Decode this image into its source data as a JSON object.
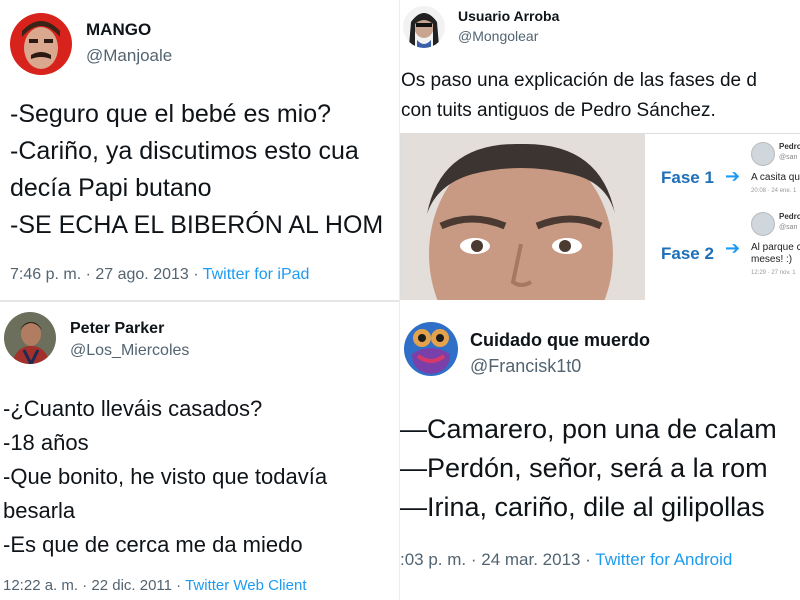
{
  "tweets": {
    "a": {
      "name": "MANGO",
      "handle": "@Manjoale",
      "lines": [
        "-Seguro que el bebé es mio?",
        "-Cariño, ya discutimos esto cua",
        "decía Papi butano",
        "-SE ECHA EL BIBERÓN AL HOM"
      ],
      "time": "7:46 p. m. · 27 ago. 2013 · ",
      "source": "Twitter for iPad"
    },
    "b": {
      "name": "Usuario Arroba",
      "handle": "@Mongolear",
      "lines": [
        "Os paso una explicación de las fases de d",
        "con tuits antiguos de Pedro Sánchez."
      ],
      "media": {
        "phase1": "Fase 1",
        "phase2": "Fase 2",
        "tweet1": {
          "name": "Pedro",
          "handle": "@san",
          "text": "A casita qu",
          "meta": "20:08 · 24 ene. 1"
        },
        "tweet2": {
          "name": "Pedro",
          "handle": "@san",
          "text_1": "Al parque c",
          "text_2": "meses! :)",
          "meta": "12:29 · 27 nov. 1"
        }
      }
    },
    "c": {
      "name": "Peter Parker",
      "handle": "@Los_Miercoles",
      "lines": [
        "-¿Cuanto lleváis casados?",
        "-18 años",
        "-Que bonito, he visto que todavía",
        "besarla",
        "-Es que de cerca me da miedo"
      ],
      "time": "12:22 a. m. · 22 dic. 2011 · ",
      "source": "Twitter Web Client"
    },
    "d": {
      "name": "Cuidado que muerdo",
      "handle": "@Francisk1t0",
      "lines": [
        "—Camarero, pon una de calam",
        "—Perdón, señor, será a la rom",
        "—Irina, cariño, dile al gilipollas"
      ],
      "time": ":03 p. m. · 24 mar. 2013 · ",
      "source": "Twitter for Android"
    }
  },
  "colors": {
    "link": "#1d9bf0",
    "meta": "#536471",
    "text": "#0f1419"
  }
}
